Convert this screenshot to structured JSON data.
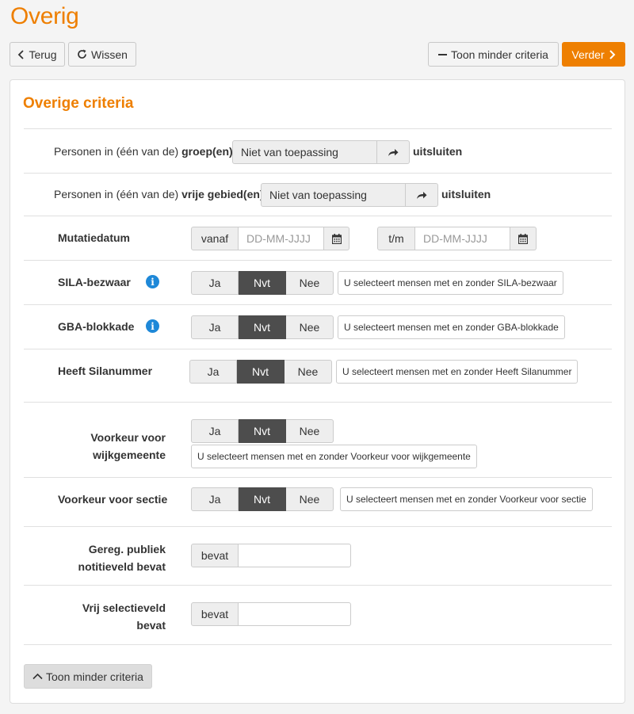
{
  "page": {
    "title": "Overig"
  },
  "toolbar": {
    "back_label": "Terug",
    "clear_label": "Wissen",
    "less_label": "Toon minder criteria",
    "next_label": "Verder"
  },
  "card": {
    "title": "Overige criteria"
  },
  "groups": {
    "prefix": "Personen in (één van de)",
    "bold": "groep(en)",
    "value": "Niet van toepassing",
    "suffix": "uitsluiten"
  },
  "areas": {
    "prefix": "Personen in (één van de)",
    "bold": "vrije gebied(en)",
    "value": "Niet van toepassing",
    "suffix": "uitsluiten"
  },
  "mutation": {
    "label": "Mutatiedatum",
    "from_label": "vanaf",
    "from_placeholder": "DD-MM-JJJJ",
    "to_label": "t/m",
    "to_placeholder": "DD-MM-JJJJ"
  },
  "sila": {
    "label": "SILA-bezwaar",
    "options": [
      "Ja",
      "Nvt",
      "Nee"
    ],
    "hint": "U selecteert mensen met en zonder SILA-bezwaar"
  },
  "gba": {
    "label": "GBA-blokkade",
    "options": [
      "Ja",
      "Nvt",
      "Nee"
    ],
    "hint": "U selecteert mensen met en zonder GBA-blokkade"
  },
  "silanummer": {
    "label": "Heeft Silanummer",
    "options": [
      "Ja",
      "Nvt",
      "Nee"
    ],
    "hint": "U selecteert mensen met en zonder Heeft Silanummer"
  },
  "wijkgemeente": {
    "label_line1": "Voorkeur voor",
    "label_line2": "wijkgemeente",
    "options": [
      "Ja",
      "Nvt",
      "Nee"
    ],
    "hint": "U selecteert mensen met en zonder Voorkeur voor wijkgemeente"
  },
  "sectie": {
    "label": "Voorkeur voor sectie",
    "options": [
      "Ja",
      "Nvt",
      "Nee"
    ],
    "hint": "U selecteert mensen met en zonder Voorkeur voor sectie"
  },
  "notitie": {
    "label_line1": "Gereg. publiek",
    "label_line2": "notitieveld bevat",
    "addon": "bevat",
    "value": ""
  },
  "vrij": {
    "label_line1": "Vrij selectieveld",
    "label_line2": "bevat",
    "addon": "bevat",
    "value": ""
  },
  "footer": {
    "less_label": "Toon minder criteria"
  },
  "colors": {
    "accent": "#ee7f01",
    "info": "#1e88d8",
    "active_segment": "#4d4d4d"
  },
  "icons": [
    "chevron-left-icon",
    "refresh-icon",
    "minus-icon",
    "chevron-right-icon",
    "share-arrow-icon",
    "calendar-icon",
    "info-icon",
    "chevron-up-icon"
  ]
}
